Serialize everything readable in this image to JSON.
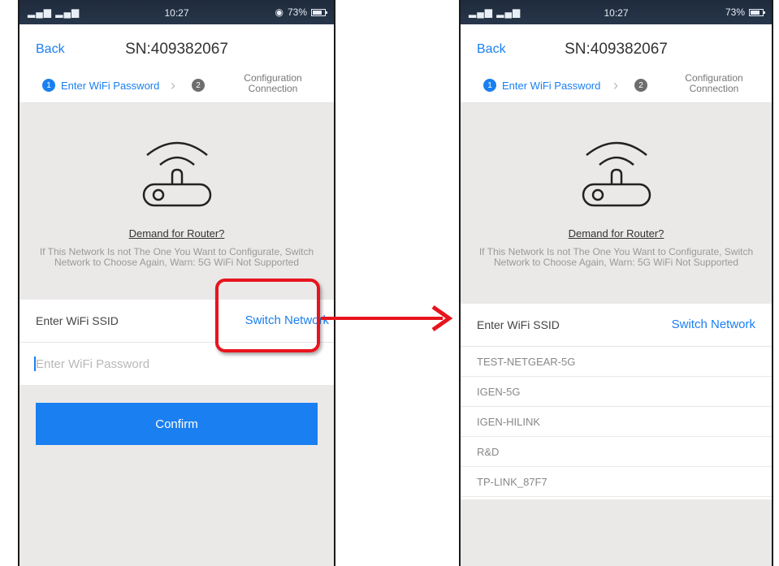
{
  "left": {
    "status": {
      "signal": "▂▄▆ ▂▄▆",
      "wifi_icon": "wifi-icon",
      "time": "10:27",
      "battery": "73%"
    },
    "nav": {
      "back": "Back",
      "title": "SN:409382067"
    },
    "steps": {
      "step1_num": "1",
      "step1_label": "Enter WiFi Password",
      "step2_num": "2",
      "step2_label_line1": "Configuration",
      "step2_label_line2": "Connection"
    },
    "router": {
      "link": "Demand for Router?",
      "note": "If This Network Is not The One You Want to Configurate, Switch Network to Choose Again, Warn: 5G WiFi Not Supported"
    },
    "ssid": {
      "label": "Enter WiFi SSID",
      "switch": "Switch Network"
    },
    "password": {
      "placeholder": "Enter WiFi Password"
    },
    "confirm": "Confirm"
  },
  "right": {
    "status": {
      "signal": "▂▄▆ ▂▄▆",
      "time": "10:27",
      "battery": "73%"
    },
    "nav": {
      "back": "Back",
      "title": "SN:409382067"
    },
    "steps": {
      "step1_num": "1",
      "step1_label": "Enter WiFi Password",
      "step2_num": "2",
      "step2_label_line1": "Configuration",
      "step2_label_line2": "Connection"
    },
    "router": {
      "link": "Demand for Router?",
      "note": "If This Network Is not The One You Want to Configurate, Switch Network to Choose Again, Warn: 5G WiFi Not Supported"
    },
    "ssid": {
      "label": "Enter WiFi SSID",
      "switch": "Switch Network"
    },
    "networks": [
      "TEST-NETGEAR-5G",
      "IGEN-5G",
      "IGEN-HILINK",
      "R&D",
      "TP-LINK_87F7"
    ]
  },
  "colors": {
    "accent": "#1a7ff0",
    "highlight": "#e8141d",
    "panel_bg": "#ebe9e8"
  }
}
